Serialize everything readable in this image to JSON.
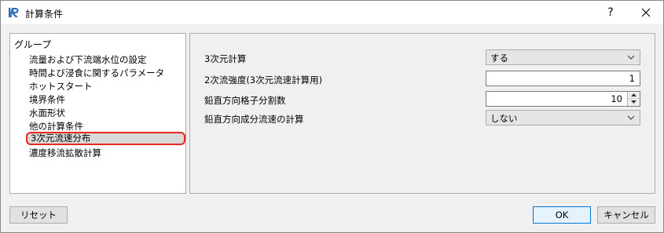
{
  "window": {
    "title": "計算条件",
    "help_label": "?",
    "app_icon": "iric-logo-icon",
    "close_icon": "close-icon"
  },
  "group": {
    "header": "グループ",
    "items": [
      {
        "label": "流量および下流端水位の設定"
      },
      {
        "label": "時間よび浸食に関するパラメータ"
      },
      {
        "label": "ホットスタート"
      },
      {
        "label": "境界条件"
      },
      {
        "label": "水面形状"
      },
      {
        "label": "他の計算条件"
      },
      {
        "label": "3次元流速分布"
      },
      {
        "label": "濃度移流拡散計算"
      }
    ],
    "selected_index": 6,
    "selected_highlight_color": "#e8261c"
  },
  "settings": {
    "three_d_calc": {
      "label": "3次元計算",
      "value": "する"
    },
    "secondary_flow_strength": {
      "label": "2次流強度(3次元流速計算用)",
      "value": "1"
    },
    "vertical_grid_divisions": {
      "label": "鉛直方向格子分割数",
      "value": "10"
    },
    "vertical_component_calc": {
      "label": "鉛直方向成分流速の計算",
      "value": "しない"
    }
  },
  "buttons": {
    "reset": "リセット",
    "ok": "OK",
    "cancel": "キャンセル"
  },
  "colors": {
    "accent": "#0078d7",
    "window_bg": "#f0f0f0"
  }
}
